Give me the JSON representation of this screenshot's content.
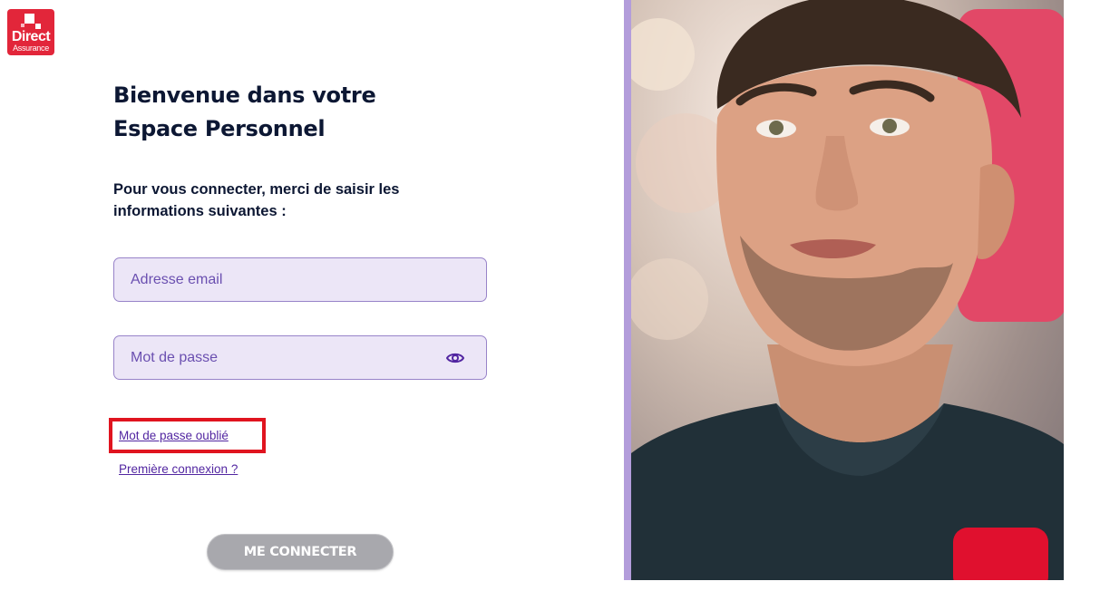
{
  "brand": {
    "name_line1": "Direct",
    "name_line2": "Assurance",
    "color": "#e2263a"
  },
  "heading": {
    "line1": "Bienvenue dans votre",
    "line2": "Espace Personnel"
  },
  "intro": {
    "line1": "Pour vous connecter, merci de saisir les",
    "line2": "informations suivantes :"
  },
  "form": {
    "email_placeholder": "Adresse email",
    "email_value": "",
    "password_placeholder": "Mot de passe",
    "password_value": "",
    "password_toggle_icon": "eye-icon"
  },
  "links": {
    "forgot_password": "Mot de passe oublié",
    "first_login": "Première connexion ?"
  },
  "submit": {
    "label": "ME CONNECTER",
    "state": "disabled"
  },
  "colors": {
    "accent": "#5226a1",
    "field_bg": "#ece6f7",
    "highlight": "#e0141f",
    "button_disabled": "#a8a8ad"
  }
}
